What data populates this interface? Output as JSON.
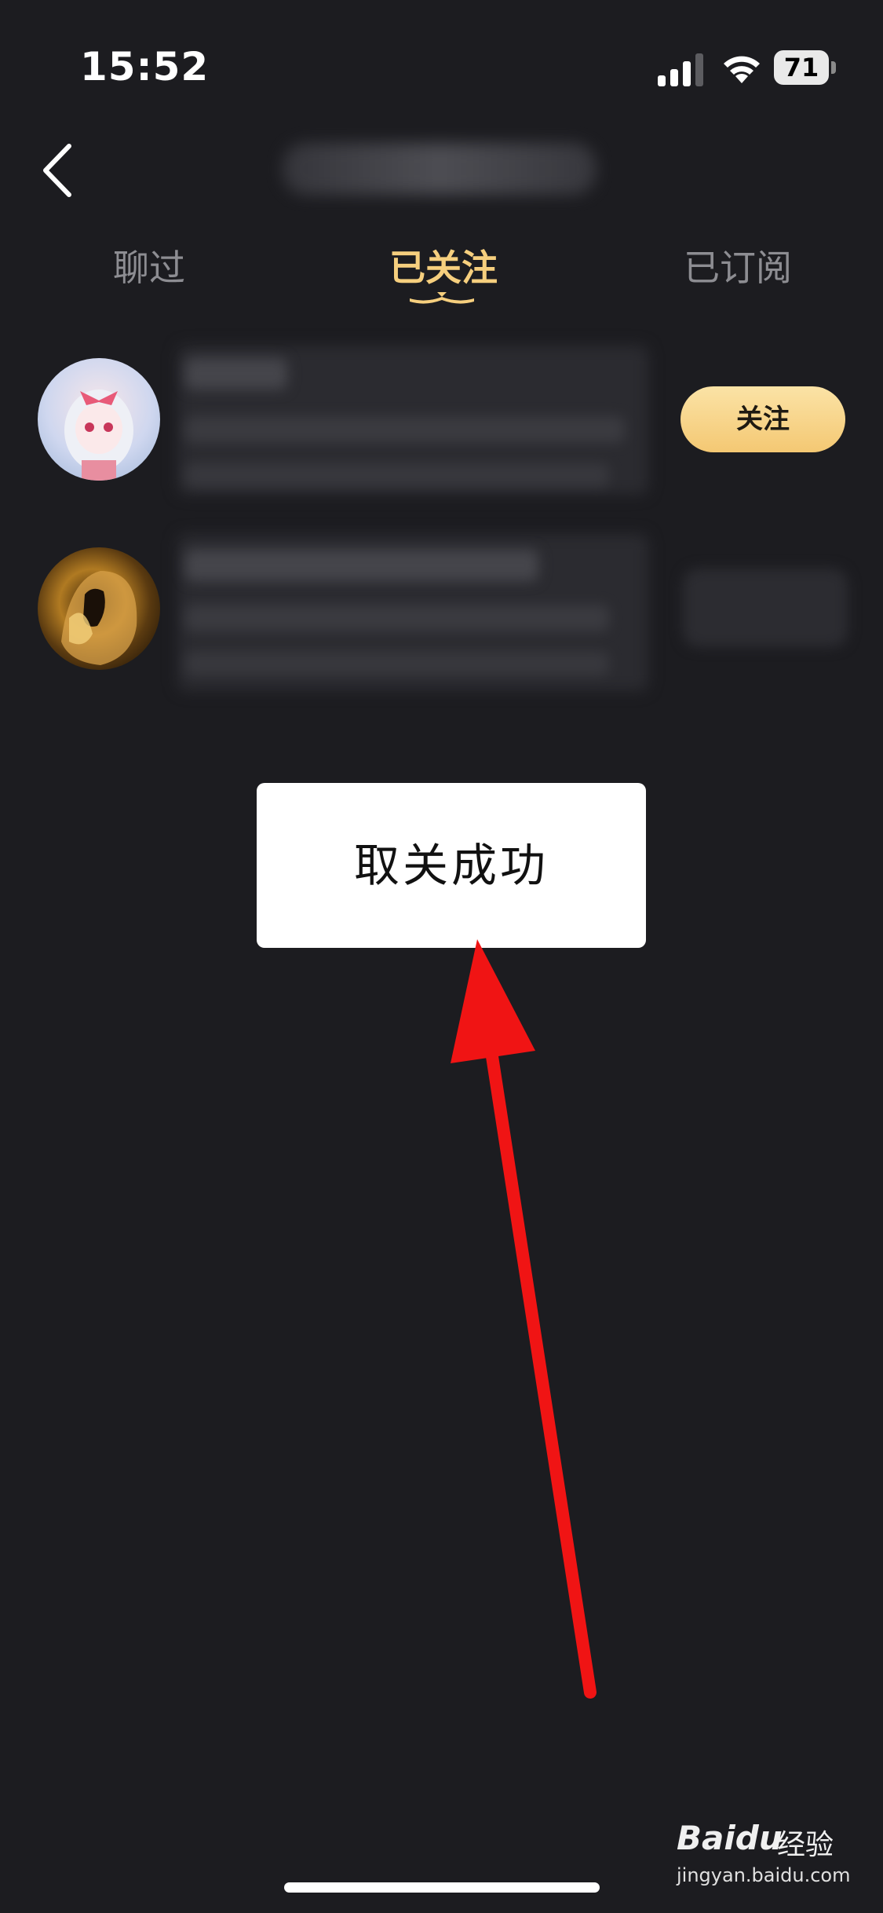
{
  "status_bar": {
    "time": "15:52",
    "battery": "71",
    "icons": [
      "signal-icon",
      "wifi-icon",
      "battery-icon"
    ]
  },
  "nav": {
    "back_icon": "chevron-left-icon",
    "title_blurred": true
  },
  "tabs": [
    {
      "label": "聊过",
      "active": false
    },
    {
      "label": "已关注",
      "active": true
    },
    {
      "label": "已订阅",
      "active": false
    }
  ],
  "list": {
    "items": [
      {
        "name_blurred": true,
        "button_label": "关注"
      },
      {
        "name_blurred": true,
        "button_blurred": true
      }
    ]
  },
  "toast": {
    "message": "取关成功"
  },
  "watermark": {
    "brand": "Bai",
    "brand_suffix": "du",
    "cn": "经验",
    "url": "jingyan.baidu.com"
  },
  "colors": {
    "background": "#1c1c20",
    "accent": "#f6cf7e",
    "follow_button": "#f4c873",
    "annotation_arrow": "#f01414"
  }
}
